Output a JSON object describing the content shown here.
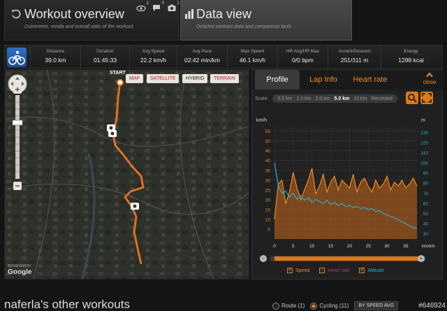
{
  "header": {
    "overview_title": "Workout overview",
    "overview_subtitle": "Comments, media and overall stats of the workout",
    "counters": [
      {
        "icon": "eye-icon",
        "count": "1"
      },
      {
        "icon": "comment-icon",
        "count": "0"
      },
      {
        "icon": "camera-icon",
        "count": "2"
      }
    ],
    "dataview_title": "Data view",
    "dataview_subtitle": "Detailed workout data and comparison tools"
  },
  "stats": [
    {
      "label": "Distance",
      "value": "39.0 km"
    },
    {
      "label": "Duration",
      "value": "01:45:33"
    },
    {
      "label": "Avg Speed",
      "value": "22.2 km/h"
    },
    {
      "label": "Avg Pace",
      "value": "02:42 min/km"
    },
    {
      "label": "Max Speed",
      "value": "46.1 km/h"
    },
    {
      "label": "HR Avg/HR Max",
      "value": "0/0 bpm"
    },
    {
      "label": "Ascent/Descent",
      "value": "251/311 m"
    },
    {
      "label": "Energy",
      "value": "1288 kcal"
    }
  ],
  "map": {
    "types": [
      "MAP",
      "SATELLITE",
      "HYBRID",
      "TERRAIN"
    ],
    "active_type": "SATELLITE",
    "start_label": "START",
    "powered_by": "POWERED BY",
    "provider": "Google"
  },
  "panel": {
    "tabs": [
      "Profile",
      "Lap Info",
      "Heart rate"
    ],
    "active_tab": "Profile",
    "close_label": "close",
    "scale_label": "Scale:",
    "scale_options": [
      "0.5 km",
      "1.0 km",
      "2.0 km",
      "5.0 km",
      "10 km",
      "Recorded"
    ],
    "active_scale": "5.0 km"
  },
  "chart_data": {
    "type": "line",
    "left_unit": "km/h",
    "right_unit": "m",
    "x_unit": "min/km",
    "x_ticks": [
      0,
      5,
      10,
      15,
      20,
      25,
      30,
      35
    ],
    "xlim": [
      0,
      38
    ],
    "left_ticks": [
      5,
      10,
      15,
      20,
      25,
      30,
      35,
      40,
      45,
      50,
      55
    ],
    "left_ylim": [
      0,
      57
    ],
    "right_ticks": [
      30,
      40,
      50,
      60,
      70,
      80,
      90,
      100,
      110,
      120,
      130
    ],
    "right_ylim": [
      25,
      135
    ],
    "series": [
      {
        "name": "Speed",
        "axis": "left",
        "color": "#f08a24",
        "x": [
          0,
          1,
          2,
          3,
          4,
          5,
          6,
          7,
          8,
          9,
          10,
          11,
          12,
          13,
          14,
          15,
          16,
          17,
          18,
          19,
          20,
          21,
          22,
          23,
          24,
          25,
          26,
          27,
          28,
          29,
          30,
          31,
          32,
          33,
          34,
          35,
          36,
          37,
          38
        ],
        "values": [
          10,
          28,
          30,
          18,
          24,
          34,
          26,
          20,
          25,
          30,
          36,
          23,
          27,
          33,
          24,
          29,
          32,
          25,
          30,
          28,
          26,
          33,
          24,
          29,
          31,
          27,
          24,
          30,
          26,
          28,
          32,
          25,
          29,
          27,
          30,
          26,
          28,
          31,
          27
        ]
      },
      {
        "name": "Altitude",
        "axis": "right",
        "color": "#2ab0c8",
        "x": [
          0,
          1,
          2,
          3,
          4,
          5,
          6,
          7,
          8,
          9,
          10,
          11,
          12,
          13,
          14,
          15,
          16,
          17,
          18,
          19,
          20,
          21,
          22,
          23,
          24,
          25,
          26,
          27,
          28,
          29,
          30,
          31,
          32,
          33,
          34,
          35,
          36,
          37,
          38
        ],
        "values": [
          100,
          78,
          70,
          72,
          66,
          70,
          64,
          68,
          63,
          66,
          61,
          64,
          62,
          60,
          63,
          59,
          61,
          58,
          60,
          57,
          58,
          56,
          57,
          55,
          56,
          54,
          55,
          52,
          53,
          50,
          49,
          47,
          46,
          44,
          42,
          40,
          38,
          36,
          36
        ]
      }
    ],
    "legend": [
      {
        "name": "Speed",
        "checked": true
      },
      {
        "name": "Heart rate",
        "checked": false
      },
      {
        "name": "Altitude",
        "checked": true
      }
    ]
  },
  "bottom": {
    "title": "naferla's other workouts",
    "filters": [
      {
        "label": "Route (1)",
        "selected": false
      },
      {
        "label": "Cycling (11)",
        "selected": true
      }
    ],
    "sort_button": "BY SPEED AVG",
    "watermark": "#646924"
  },
  "colors": {
    "accent": "#f08a24",
    "altitude": "#2ab0c8",
    "sport_blue": "#2f6fc4"
  }
}
